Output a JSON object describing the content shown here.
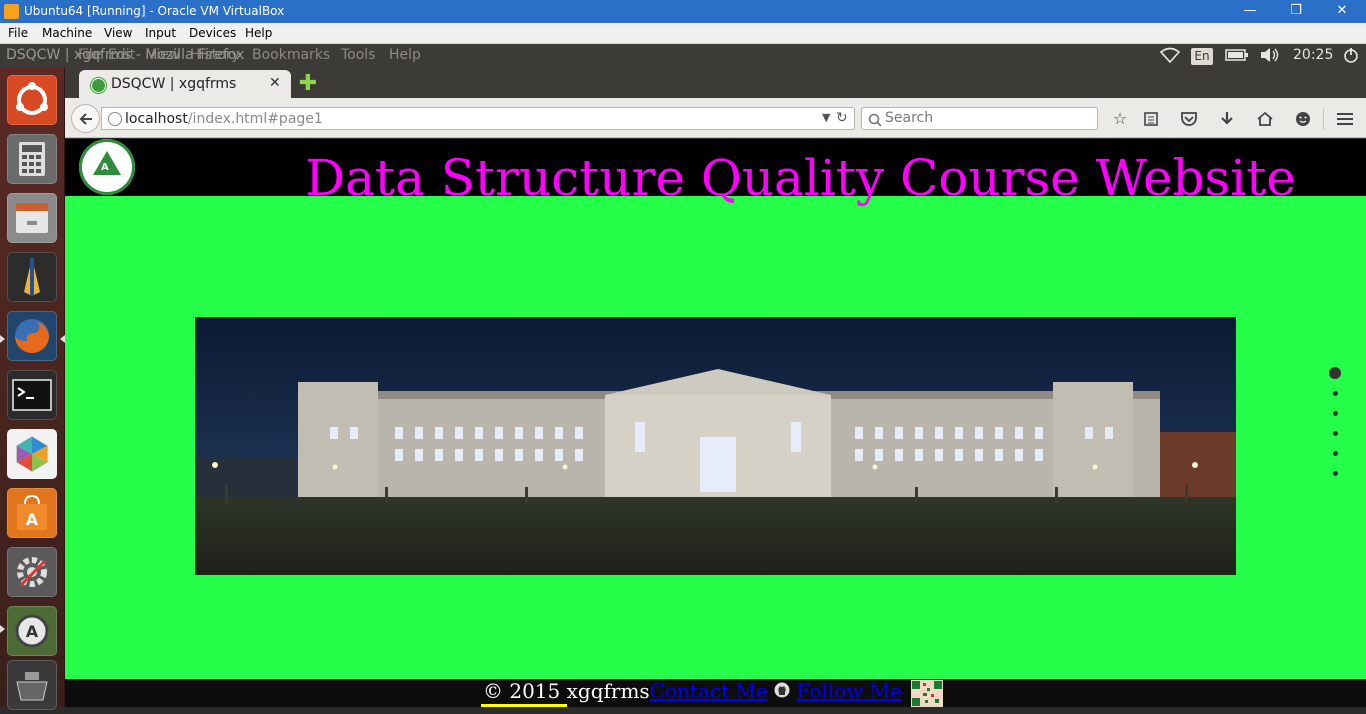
{
  "vbox": {
    "title": "Ubuntu64 [Running] - Oracle VM VirtualBox",
    "menu": [
      "File",
      "Machine",
      "View",
      "Input",
      "Devices",
      "Help"
    ],
    "controls": {
      "minimize": "—",
      "restore": "❐",
      "close": "✕"
    }
  },
  "panel": {
    "ghost_title": "DSQCW | xgqfrms - Mozilla Firefox",
    "firefox_menu": [
      "File",
      "Edit",
      "View",
      "History",
      "Bookmarks",
      "Tools",
      "Help"
    ],
    "keyboard_layout": "En",
    "time": "20:25"
  },
  "launcher": {
    "items": [
      {
        "name": "ubuntu-dash-icon",
        "color": "#d84a23"
      },
      {
        "name": "calculator-icon",
        "color": "#6b6b6b"
      },
      {
        "name": "files-icon",
        "color": "#8a8a8a"
      },
      {
        "name": "bluefish-editor-icon",
        "color": "#2c2c2c"
      },
      {
        "name": "firefox-icon",
        "color": "#e76a1c"
      },
      {
        "name": "terminal-icon",
        "color": "#2b2b2b"
      },
      {
        "name": "libreoffice-icon",
        "color": "#f2f2f2"
      },
      {
        "name": "software-center-icon",
        "color": "#e1761d"
      },
      {
        "name": "system-settings-icon",
        "color": "#5a5a5a"
      },
      {
        "name": "software-updater-icon",
        "color": "#4d6b35"
      },
      {
        "name": "trash-icon",
        "color": "#3a3a3a"
      }
    ]
  },
  "browser": {
    "tab_title": "DSQCW | xgqfrms",
    "new_tab": "✚",
    "url_host": "localhost",
    "url_path": "/index.html#page1",
    "search_placeholder": "Search"
  },
  "site": {
    "title": "Data Structure Quality Course Website",
    "background": "#26ff49",
    "title_color": "#ff00ff",
    "footer": {
      "copyright": "© 2015 xgqfrms",
      "contact": "Contact Me",
      "follow": "Follow Me"
    },
    "page_dots": 6,
    "active_dot": 1
  }
}
